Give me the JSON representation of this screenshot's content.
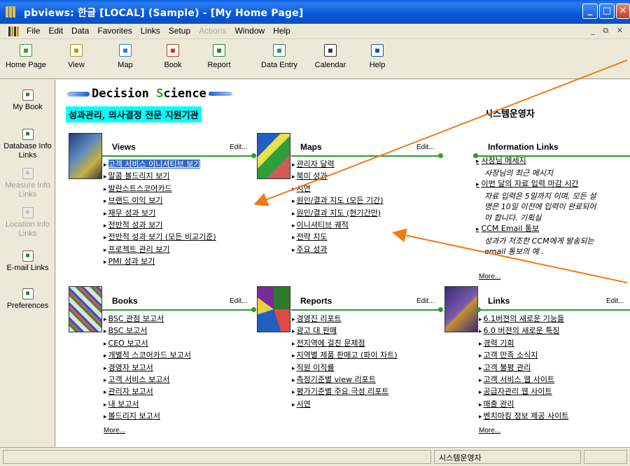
{
  "window": {
    "title": "pbviews: 한글 [LOCAL] (Sample) - [My Home Page]"
  },
  "menu": [
    {
      "label": "File",
      "enabled": true
    },
    {
      "label": "Edit",
      "enabled": true
    },
    {
      "label": "Data",
      "enabled": true
    },
    {
      "label": "Favorites",
      "enabled": true
    },
    {
      "label": "Links",
      "enabled": true
    },
    {
      "label": "Setup",
      "enabled": true
    },
    {
      "label": "Actions",
      "enabled": false
    },
    {
      "label": "Window",
      "enabled": true
    },
    {
      "label": "Help",
      "enabled": true
    }
  ],
  "toolbar": [
    {
      "label": "Home Page",
      "icon": "home-icon",
      "color": "#3a9b2b"
    },
    {
      "label": "View",
      "icon": "view-icon",
      "color": "#b79417"
    },
    {
      "label": "Map",
      "icon": "map-icon",
      "color": "#2f7bd0"
    },
    {
      "label": "Book",
      "icon": "book-icon",
      "color": "#c0392b"
    },
    {
      "label": "Report",
      "icon": "report-icon",
      "color": "#2c7c2c"
    },
    {
      "label": "Data Entry",
      "icon": "data-entry-icon",
      "color": "#2b8a5d"
    },
    {
      "label": "Calendar",
      "icon": "calendar-icon",
      "color": "#333333"
    },
    {
      "label": "Help",
      "icon": "help-icon",
      "color": "#0c4fbd"
    }
  ],
  "sidebar": [
    {
      "label": "My Book",
      "icon": "my-book-icon",
      "enabled": true
    },
    {
      "label": "Database Info Links",
      "icon": "database-icon",
      "enabled": true
    },
    {
      "label": "Measure Info Links",
      "icon": "measure-icon",
      "enabled": false
    },
    {
      "label": "Location Info Links",
      "icon": "location-icon",
      "enabled": false
    },
    {
      "label": "E-mail Links",
      "icon": "email-icon",
      "enabled": true
    },
    {
      "label": "Preferences",
      "icon": "preferences-icon",
      "enabled": true
    }
  ],
  "header": {
    "logo_text_a": "Decision ",
    "logo_text_s": "S",
    "logo_text_b": "cience",
    "tagline": "성과관리, 의사결정 전문 지원기관",
    "user": "시스템운영자"
  },
  "views": {
    "title": "Views",
    "edit": "Edit...",
    "items": [
      "고객 서비스 이니셔티브 보기",
      "말콤 볼드리지 보기",
      "발란스트스코어카드",
      "브랜드 이익 보기",
      "재무 성과 보기",
      "전반적 성과 보기",
      "전반적 성과 보기 (모든 비교기준)",
      "프로젝트 관리 보기",
      "PMI 성과 보기"
    ]
  },
  "maps": {
    "title": "Maps",
    "edit": "Edit...",
    "items": [
      "관리자 달력",
      "북미 성과",
      "시연",
      "원인/결과 지도 (모든 기간)",
      "원인/결과 지도 (현기간만)",
      "이니셔티브 궤적",
      "전략 지도",
      "주요 성과"
    ]
  },
  "info_links": {
    "title": "Information Links",
    "items": [
      {
        "title": "사장님 메세지",
        "desc": [
          "사장님의 최근 메시지"
        ]
      },
      {
        "title": "이번 달의 자료 입력 마감 시간",
        "desc": [
          "자료 입력은 5일까지 이며, 모든 설",
          "명은 10일 이전에 입력이 완료되어",
          "야 합니다.  기획실"
        ]
      },
      {
        "title": "CCM Email 통보",
        "desc": [
          "성과가 저조한 CCM에게 발송되는",
          "email 통보의 예 ."
        ]
      }
    ],
    "more": "More..."
  },
  "books": {
    "title": "Books",
    "edit": "Edit...",
    "items": [
      "BSC 관점 보고서",
      "BSC 보고서",
      "CEO 보고서",
      "개별적 스코어카드 보고서",
      "경영자 보고서",
      "고객 서비스 보고서",
      "관리자 보고서",
      "내 보고서",
      "볼드리지 보고서"
    ],
    "more": "More..."
  },
  "reports": {
    "title": "Reports",
    "edit": "Edit...",
    "items": [
      "경영진 리포트",
      "광고 대 판매",
      "전지역에 걸친 문제점",
      "지역별 제품 판매고 (파이 차트)",
      "직원 이직률",
      "측정기준별 view 리포트",
      "평가기준별 주요 극성 리포트",
      "시연"
    ]
  },
  "links": {
    "title": "Links",
    "edit": "Edit...",
    "items": [
      "6.1버젼의 새로운 기능들",
      "6.0 버젼의 새로운 특징",
      "경력 기회",
      "고객 만족 소식지",
      "고객 불평 관리",
      "고객 서비스 웹 사이트",
      "공급자관리 웹 사이트",
      "매출 관리",
      "벤치마킹 정보 제공 사이트"
    ],
    "more": "More..."
  },
  "status": {
    "user": "시스템운영자"
  },
  "colors": {
    "accent_green": "#2c9c2c",
    "selection": "#316ac5",
    "titlebar": "#0857d8",
    "tagline_bg": "#00ffff"
  }
}
